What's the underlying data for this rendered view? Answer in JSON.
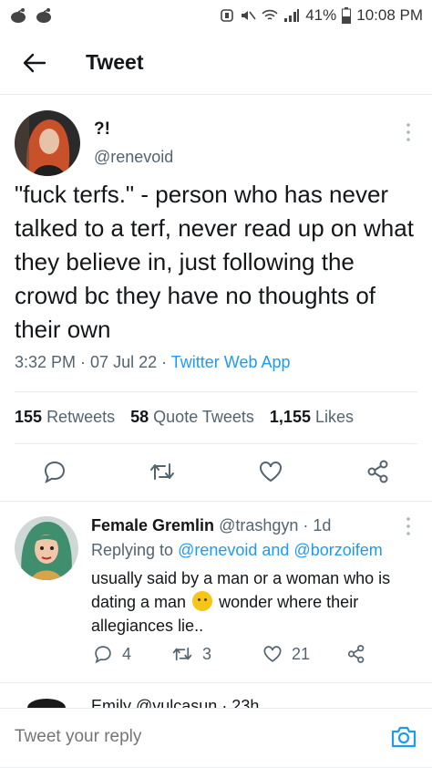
{
  "status": {
    "battery": "41%",
    "time": "10:08 PM"
  },
  "header": {
    "title": "Tweet"
  },
  "tweet": {
    "name": "?!",
    "handle": "@renevoid",
    "text": "\"fuck terfs.\" - person who has never talked to a terf, never read up on what they believe in, just following the crowd bc they have no thoughts of their own",
    "time": "3:32 PM",
    "date": "07 Jul 22",
    "source": "Twitter Web App",
    "stats": {
      "retweets": "155",
      "retweets_label": "Retweets",
      "quotes": "58",
      "quotes_label": "Quote Tweets",
      "likes": "1,155",
      "likes_label": "Likes"
    }
  },
  "reply": {
    "name": "Female Gremlin",
    "handle": "@trashgyn",
    "age": "1d",
    "replying_prefix": "Replying to",
    "replying_to": "@renevoid and @borzoifem",
    "text_before": "usually said by a man or a woman who is dating a man",
    "text_after": "wonder where their allegiances lie..",
    "counts": {
      "replies": "4",
      "retweets": "3",
      "likes": "21"
    }
  },
  "peek": {
    "text": "Emily @vulcasun · 23h"
  },
  "compose": {
    "placeholder": "Tweet your reply"
  },
  "colors": {
    "accent": "#1d9bf0",
    "muted": "#536471",
    "text": "#14171a"
  }
}
